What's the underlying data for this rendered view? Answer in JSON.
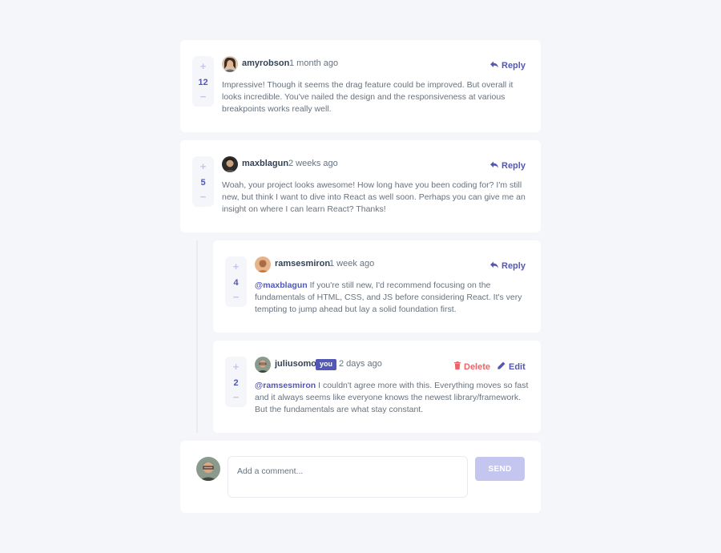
{
  "colors": {
    "background": "#f5f6fa",
    "card": "#ffffff",
    "accent": "#5357b6",
    "accent_light": "#c5c6ef",
    "danger": "#ed6368",
    "text_dark": "#334253",
    "text": "#67727e"
  },
  "comments": [
    {
      "score": "12",
      "username": "amyrobson",
      "date": "1 month ago",
      "reply_label": "Reply",
      "content": "Impressive! Though it seems the drag feature could be improved. But overall it looks incredible. You've nailed the design and the responsiveness at various breakpoints works really well."
    },
    {
      "score": "5",
      "username": "maxblagun",
      "date": "2 weeks ago",
      "reply_label": "Reply",
      "content": "Woah, your project looks awesome! How long have you been coding for? I'm still new, but think I want to dive into React as well soon. Perhaps you can give me an insight on where I can learn React? Thanks!"
    }
  ],
  "replies": [
    {
      "score": "4",
      "username": "ramsesmiron",
      "date": "1 week ago",
      "reply_label": "Reply",
      "mention": "@maxblagun",
      "content": " If you're still new, I'd recommend focusing on the fundamentals of HTML, CSS, and JS before considering React. It's very tempting to jump ahead but lay a solid foundation first."
    },
    {
      "score": "2",
      "username": "juliusomo",
      "you_badge": "you",
      "date": "2 days ago",
      "delete_label": "Delete",
      "edit_label": "Edit",
      "mention": "@ramsesmiron",
      "content": " I couldn't agree more with this. Everything moves so fast and it always seems like everyone knows the newest library/framework. But the fundamentals are what stay constant."
    }
  ],
  "vote": {
    "plus": "+",
    "minus": "−"
  },
  "new_comment": {
    "placeholder": "Add a comment...",
    "send_label": "SEND"
  },
  "icons": {
    "reply": "reply-arrow-icon",
    "delete": "trash-icon",
    "edit": "pencil-icon"
  }
}
